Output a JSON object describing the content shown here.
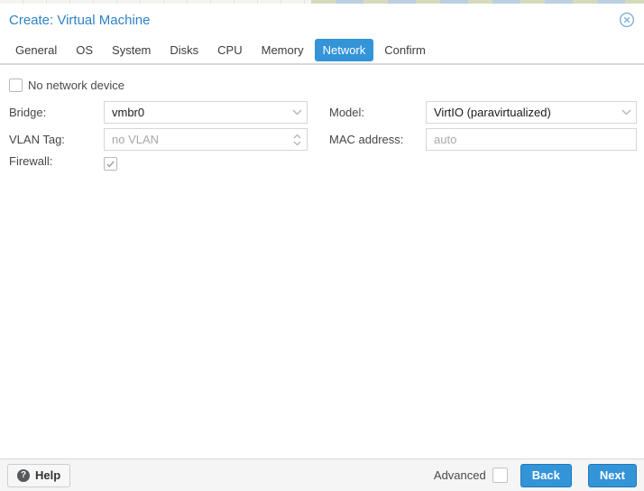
{
  "colors": {
    "accent": "#3494d8",
    "accent_border": "#1f79bb",
    "title": "#2e83c6",
    "placeholder": "#a8a8a8"
  },
  "dialog": {
    "title": "Create: Virtual Machine",
    "close_icon": "circle-x-icon"
  },
  "tabs": [
    {
      "label": "General",
      "active": false
    },
    {
      "label": "OS",
      "active": false
    },
    {
      "label": "System",
      "active": false
    },
    {
      "label": "Disks",
      "active": false
    },
    {
      "label": "CPU",
      "active": false
    },
    {
      "label": "Memory",
      "active": false
    },
    {
      "label": "Network",
      "active": true
    },
    {
      "label": "Confirm",
      "active": false
    }
  ],
  "form": {
    "no_network": {
      "label": "No network device",
      "checked": false
    },
    "bridge": {
      "label": "Bridge:",
      "type": "combo",
      "value": "vmbr0"
    },
    "vlan": {
      "label": "VLAN Tag:",
      "type": "spinner",
      "value": "",
      "placeholder": "no VLAN"
    },
    "firewall": {
      "label": "Firewall:",
      "checked": true
    },
    "model": {
      "label": "Model:",
      "type": "combo",
      "value": "VirtIO (paravirtualized)"
    },
    "mac": {
      "label": "MAC address:",
      "type": "text",
      "value": "",
      "placeholder": "auto"
    }
  },
  "footer": {
    "help_label": "Help",
    "advanced_label": "Advanced",
    "advanced_checked": false,
    "back_label": "Back",
    "next_label": "Next"
  }
}
